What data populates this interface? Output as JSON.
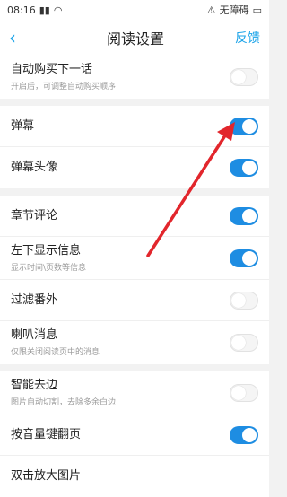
{
  "status": {
    "time": "08:16",
    "signal_icon": "signal-icon",
    "wifi_icon": "wifi-icon",
    "right_text": "无障碍",
    "battery_icon": "battery-icon"
  },
  "navbar": {
    "back_icon": "back-arrow-icon",
    "title": "阅读设置",
    "feedback": "反馈"
  },
  "settings": [
    {
      "label": "自动购买下一话",
      "sub": "开启后，可调整自动购买顺序",
      "on": false
    },
    {
      "label": "弹幕",
      "on": true
    },
    {
      "label": "弹幕头像",
      "on": true
    },
    {
      "label": "章节评论",
      "on": true
    },
    {
      "label": "左下显示信息",
      "sub": "显示时间\\页数等信息",
      "on": true
    },
    {
      "label": "过滤番外",
      "on": false
    },
    {
      "label": "喇叭消息",
      "sub": "仅限关闭阅读页中的消息",
      "on": false
    },
    {
      "label": "智能去边",
      "sub": "图片自动切割，去除多余白边",
      "on": false
    },
    {
      "label": "按音量键翻页",
      "on": true
    },
    {
      "label": "双击放大图片"
    }
  ],
  "colors": {
    "accent": "#1aa3e8",
    "toggle_on": "#1e8de2",
    "annotation_arrow": "#e2262c"
  }
}
